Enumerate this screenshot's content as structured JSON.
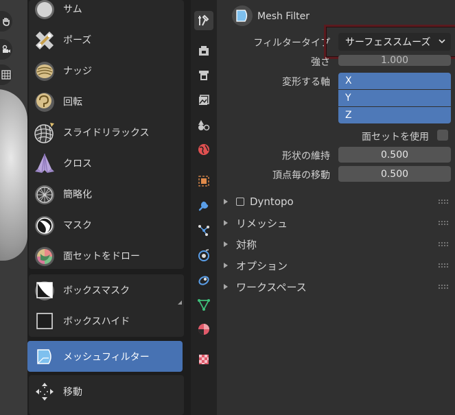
{
  "tools": [
    {
      "label": "サム",
      "icon": "thumb-brush-icon"
    },
    {
      "label": "ポーズ",
      "icon": "pose-brush-icon"
    },
    {
      "label": "ナッジ",
      "icon": "nudge-brush-icon"
    },
    {
      "label": "回転",
      "icon": "rotate-brush-icon"
    },
    {
      "label": "スライドリラックス",
      "icon": "slide-relax-brush-icon"
    },
    {
      "label": "クロス",
      "icon": "cloth-brush-icon"
    },
    {
      "label": "簡略化",
      "icon": "simplify-brush-icon"
    },
    {
      "label": "マスク",
      "icon": "mask-brush-icon"
    },
    {
      "label": "面セットをドロー",
      "icon": "draw-face-sets-icon"
    },
    {
      "label": "ボックスマスク",
      "icon": "box-mask-icon"
    },
    {
      "label": "ボックスハイド",
      "icon": "box-hide-icon"
    },
    {
      "label": "メッシュフィルター",
      "icon": "mesh-filter-icon"
    },
    {
      "label": "移動",
      "icon": "move-icon"
    }
  ],
  "properties": {
    "header_title": "Mesh Filter",
    "filter_type_label": "フィルタータイプ",
    "filter_type_value": "サーフェススムーズ",
    "strength_label": "強さ",
    "strength_value": "1.000",
    "deform_axis_label": "変形する軸",
    "axes": [
      "X",
      "Y",
      "Z"
    ],
    "use_face_sets_label": "面セットを使用",
    "shape_preservation_label": "形状の維持",
    "shape_preservation_value": "0.500",
    "per_vertex_displacement_label": "頂点毎の移動",
    "per_vertex_displacement_value": "0.500"
  },
  "panels": [
    "Dyntopo",
    "リメッシュ",
    "対称",
    "オプション",
    "ワークスペース"
  ],
  "colors": {
    "active_tool": "#4772b3",
    "axis_selected": "#4e79b8",
    "highlight_box": "#5a1a1e"
  }
}
